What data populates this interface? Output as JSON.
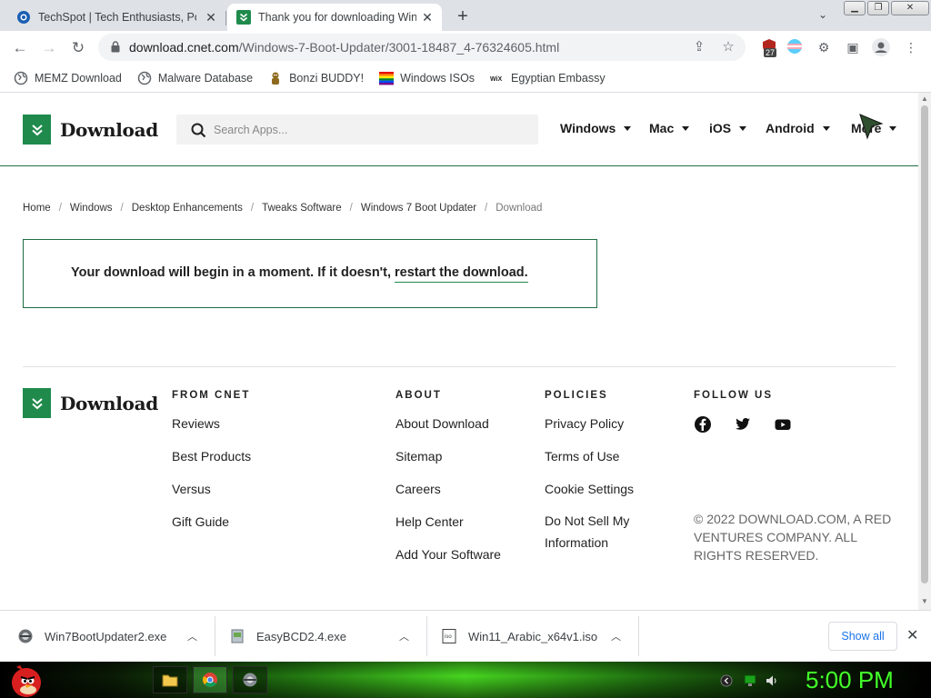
{
  "browser": {
    "tabs": [
      {
        "title": "TechSpot | Tech Enthusiasts, Pow",
        "active": false
      },
      {
        "title": "Thank you for downloading Wind",
        "active": true
      }
    ],
    "url_host": "download.cnet.com",
    "url_path": "/Windows-7-Boot-Updater/3001-18487_4-76324605.html",
    "extension_badge": "27",
    "bookmarks": [
      {
        "label": "MEMZ Download",
        "icon": "globe-icon"
      },
      {
        "label": "Malware Database",
        "icon": "globe-icon"
      },
      {
        "label": "Bonzi BUDDY!",
        "icon": "bonzi-icon"
      },
      {
        "label": "Windows ISOs",
        "icon": "windows-flag-icon"
      },
      {
        "label": "Egyptian Embassy",
        "icon": "wix-icon"
      }
    ]
  },
  "site": {
    "logo_text": "Download",
    "search_placeholder": "Search Apps...",
    "nav": [
      "Windows",
      "Mac",
      "iOS",
      "Android",
      "More"
    ],
    "breadcrumb": [
      "Home",
      "Windows",
      "Desktop Enhancements",
      "Tweaks Software",
      "Windows 7 Boot Updater",
      "Download"
    ],
    "notice_text": "Your download will begin in a moment. If it doesn't, ",
    "notice_link": "restart the download."
  },
  "footer": {
    "from_cnet": {
      "heading": "FROM CNET",
      "links": [
        "Reviews",
        "Best Products",
        "Versus",
        "Gift Guide"
      ]
    },
    "about": {
      "heading": "ABOUT",
      "links": [
        "About Download",
        "Sitemap",
        "Careers",
        "Help Center",
        "Add Your Software"
      ]
    },
    "policies": {
      "heading": "POLICIES",
      "links": [
        "Privacy Policy",
        "Terms of Use",
        "Cookie Settings",
        "Do Not Sell My Information"
      ]
    },
    "follow": {
      "heading": "FOLLOW US",
      "social": [
        "facebook-icon",
        "twitter-icon",
        "youtube-icon"
      ]
    },
    "copyright": "© 2022 DOWNLOAD.COM, A RED VENTURES COMPANY. ALL RIGHTS RESERVED."
  },
  "downloads": {
    "items": [
      "Win7BootUpdater2.exe",
      "EasyBCD2.4.exe",
      "Win11_Arabic_x64v1.iso"
    ],
    "show_all": "Show all"
  },
  "taskbar": {
    "clock": "5:00 PM"
  },
  "colors": {
    "brand_green": "#1f8a4c",
    "link_blue": "#1a73e8",
    "clock_green": "#43ff2a"
  }
}
